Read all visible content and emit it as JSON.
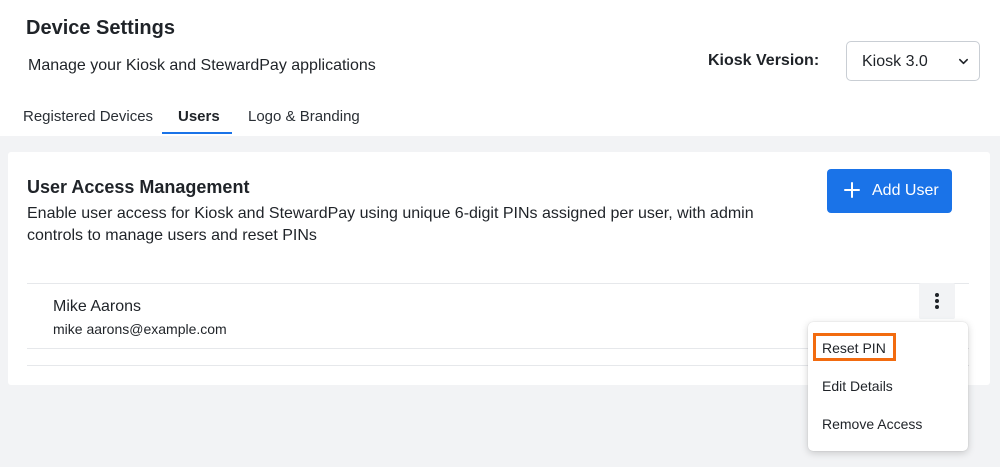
{
  "header": {
    "title": "Device Settings",
    "subtitle": "Manage your Kiosk and StewardPay applications",
    "version_label": "Kiosk Version:",
    "version_value": "Kiosk 3.0"
  },
  "tabs": [
    {
      "label": "Registered Devices",
      "active": false
    },
    {
      "label": "Users",
      "active": true
    },
    {
      "label": "Logo & Branding",
      "active": false
    }
  ],
  "card": {
    "title": "User Access Management",
    "description": "Enable user access for Kiosk and StewardPay using unique 6-digit PINs assigned per user, with admin controls to manage users and reset PINs",
    "add_button": "Add User"
  },
  "users": [
    {
      "name": "Mike Aarons",
      "email": "mike aarons@example.com"
    }
  ],
  "menu": {
    "items": [
      "Reset PIN",
      "Edit Details",
      "Remove Access"
    ],
    "highlighted": "Reset PIN"
  },
  "colors": {
    "accent": "#1a73e8",
    "highlight": "#f26b0f",
    "background": "#f2f3f5"
  },
  "icons": [
    "chevron-down-icon",
    "plus-icon",
    "more-vertical-icon"
  ]
}
